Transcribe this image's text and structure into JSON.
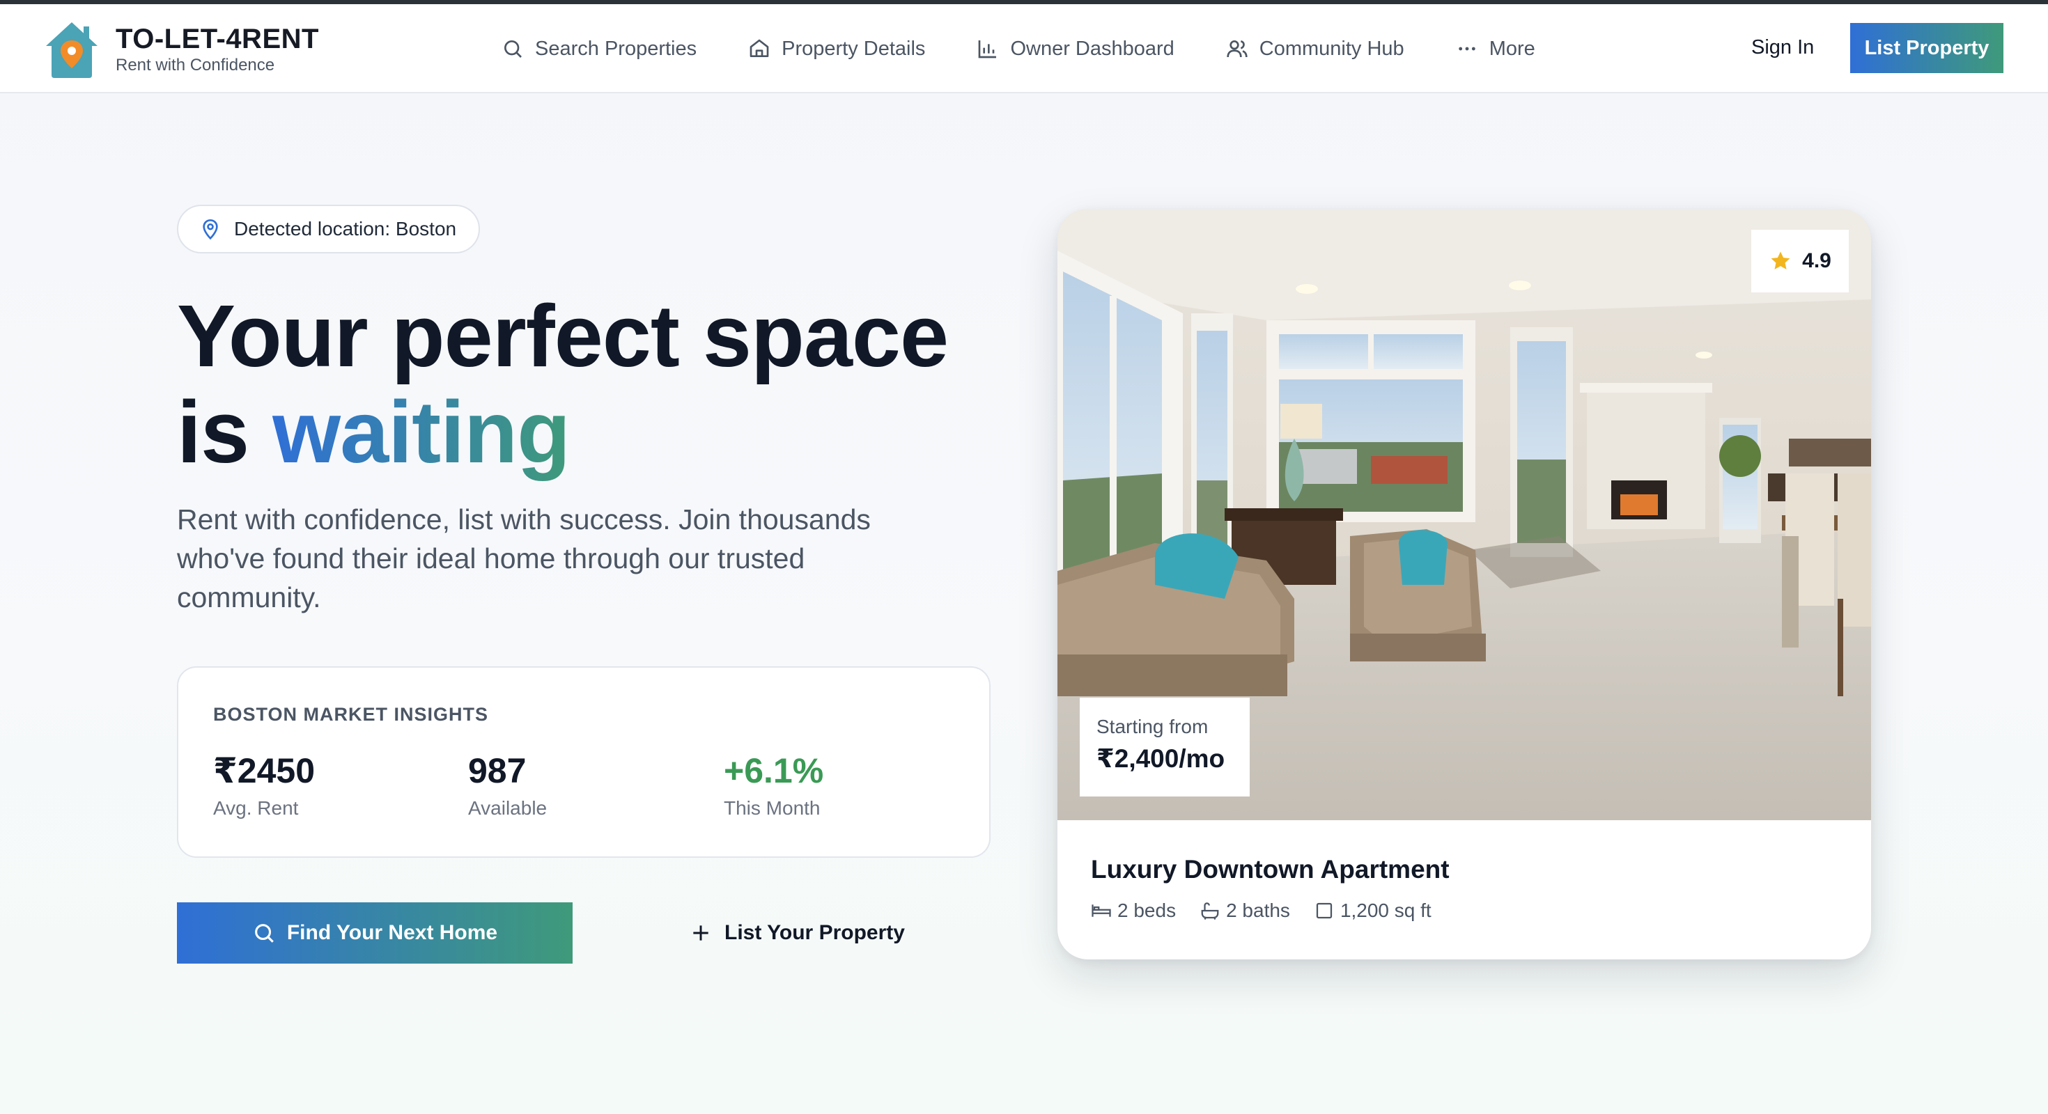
{
  "brand": {
    "title": "TO-LET-4RENT",
    "subtitle": "Rent with Confidence",
    "colors": {
      "house": "#4ba3b6",
      "pin": "#f28c28"
    }
  },
  "nav": {
    "items": [
      {
        "label": "Search Properties",
        "icon": "search-icon"
      },
      {
        "label": "Property Details",
        "icon": "home-icon"
      },
      {
        "label": "Owner Dashboard",
        "icon": "bar-chart-icon"
      },
      {
        "label": "Community Hub",
        "icon": "users-icon"
      },
      {
        "label": "More",
        "icon": "more-dots-icon"
      }
    ],
    "sign_in": "Sign In",
    "list_property": "List Property"
  },
  "hero": {
    "location": "Detected location: Boston",
    "title_line1": "Your perfect space",
    "title_line2_plain": "is ",
    "title_line2_accent": "waiting",
    "description": "Rent with confidence, list with success. Join thousands who've found their ideal home through our trusted community."
  },
  "insights": {
    "heading": "BOSTON MARKET INSIGHTS",
    "stats": [
      {
        "value": "₹2450",
        "label": "Avg. Rent"
      },
      {
        "value": "987",
        "label": "Available"
      },
      {
        "value": "+6.1%",
        "label": "This Month"
      }
    ]
  },
  "cta": {
    "primary": "Find Your Next Home",
    "secondary": "List Your Property"
  },
  "listing": {
    "rating": "4.9",
    "price_label": "Starting from",
    "price": "₹2,400/mo",
    "title": "Luxury Downtown Apartment",
    "beds": "2 beds",
    "baths": "2 baths",
    "area": "1,200 sq ft"
  },
  "colors": {
    "accent_start": "#2f6fd6",
    "accent_end": "#3f9a7a",
    "positive": "#3a9a55",
    "star": "#f2b51d"
  }
}
